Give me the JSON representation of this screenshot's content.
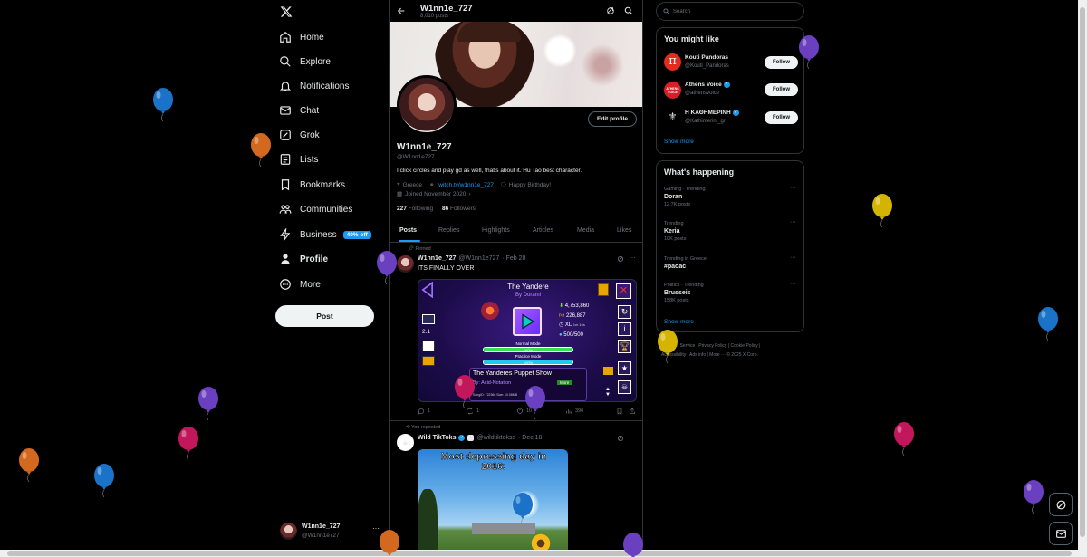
{
  "nav": {
    "items": [
      {
        "label": "Home",
        "icon": "home-icon"
      },
      {
        "label": "Explore",
        "icon": "search-icon"
      },
      {
        "label": "Notifications",
        "icon": "bell-icon"
      },
      {
        "label": "Chat",
        "icon": "mail-icon"
      },
      {
        "label": "Grok",
        "icon": "grok-icon"
      },
      {
        "label": "Lists",
        "icon": "list-icon"
      },
      {
        "label": "Bookmarks",
        "icon": "bookmark-icon"
      },
      {
        "label": "Communities",
        "icon": "communities-icon"
      },
      {
        "label": "Business",
        "icon": "lightning-icon",
        "badge": "40% off"
      },
      {
        "label": "Profile",
        "icon": "person-icon"
      },
      {
        "label": "More",
        "icon": "more-circle-icon"
      }
    ],
    "post_label": "Post",
    "account": {
      "name": "W1nn1e_727",
      "handle": "@W1nn1e727"
    }
  },
  "header": {
    "name": "W1nn1e_727",
    "posts": "8,010 posts"
  },
  "profile": {
    "edit_label": "Edit profile",
    "name": "W1nn1e_727",
    "handle": "@W1nn1e727",
    "bio": "I click circles and play gd as well, that's about it. Hu Tao best character.",
    "location": "Greece",
    "link": "twitch.tv/w1nn1e_727",
    "birthday": "Happy Birthday!",
    "joined": "Joined November 2020",
    "following_count": "227",
    "following_label": "Following",
    "followers_count": "86",
    "followers_label": "Followers"
  },
  "tabs": [
    "Posts",
    "Replies",
    "Highlights",
    "Articles",
    "Media",
    "Likes"
  ],
  "pinned_post": {
    "pinned_label": "Pinned",
    "name": "W1nn1e_727",
    "handle": "@W1nn1e727",
    "date": "· Feb 28",
    "text": "ITS FINALLY OVER",
    "game": {
      "level_title": "The Yandere",
      "author": "By Dorami",
      "downloads": "4,753,860",
      "likes": "226,887",
      "length": "XL",
      "length_sub": "1m 16s",
      "coins": "500/500",
      "normal_mode": "Normal Mode",
      "normal_pct": "100%",
      "normal_progress": 1.0,
      "practice_mode": "Practice Mode",
      "practice_pct": "100%",
      "practice_progress": 1.0,
      "side_value": "2.1",
      "song_title": "The Yanderes Puppet Show",
      "song_artist": "By: Acid-Notation",
      "song_more": "More",
      "song_meta": "SongID: 722366  Size: 10.08MB"
    },
    "actions": {
      "replies": "1",
      "reposts": "1",
      "likes": "10",
      "views": "390"
    }
  },
  "repost": {
    "repost_label": "You reposted",
    "name": "Wild TikToks",
    "handle": "@wildtiktokss",
    "date": "· Dec 18",
    "image_caption": "Most depressing day in 2016:"
  },
  "search": {
    "placeholder": "Search"
  },
  "suggestions": {
    "title": "You might like",
    "follow_label": "Follow",
    "show_more": "Show more",
    "items": [
      {
        "name": "Kouti Pandoras",
        "handle": "@Kouti_Pandoras",
        "verified": false
      },
      {
        "name": "Athens Voice",
        "handle": "@athensvoice",
        "verified": true
      },
      {
        "name": "Η ΚΑΘΗΜΕΡΙΝΗ",
        "handle": "@Kathimerini_gr",
        "verified": true
      }
    ]
  },
  "trends": {
    "title": "What's happening",
    "show_more": "Show more",
    "items": [
      {
        "meta": "Gaming · Trending",
        "name": "Doran",
        "posts": "12.7K posts"
      },
      {
        "meta": "Trending",
        "name": "Keria",
        "posts": "10K posts"
      },
      {
        "meta": "Trending in Greece",
        "name": "#paoac",
        "posts": ""
      },
      {
        "meta": "Politics · Trending",
        "name": "Brusseis",
        "posts": "158K posts"
      }
    ]
  },
  "footer": {
    "line1": "Terms of Service  |  Privacy Policy  |  Cookie Policy  |",
    "line2": "Accessibility  |  Ads info  |  More ···  © 2025 X Corp."
  },
  "colors": {
    "accent": "#1d9bf0",
    "background": "#000000",
    "border": "#2f3336",
    "balloon_blue": "#1a73c8",
    "balloon_orange": "#d2691e",
    "balloon_purple": "#6a3fc0",
    "balloon_pink": "#c2185b",
    "balloon_yellow": "#d4b400"
  }
}
